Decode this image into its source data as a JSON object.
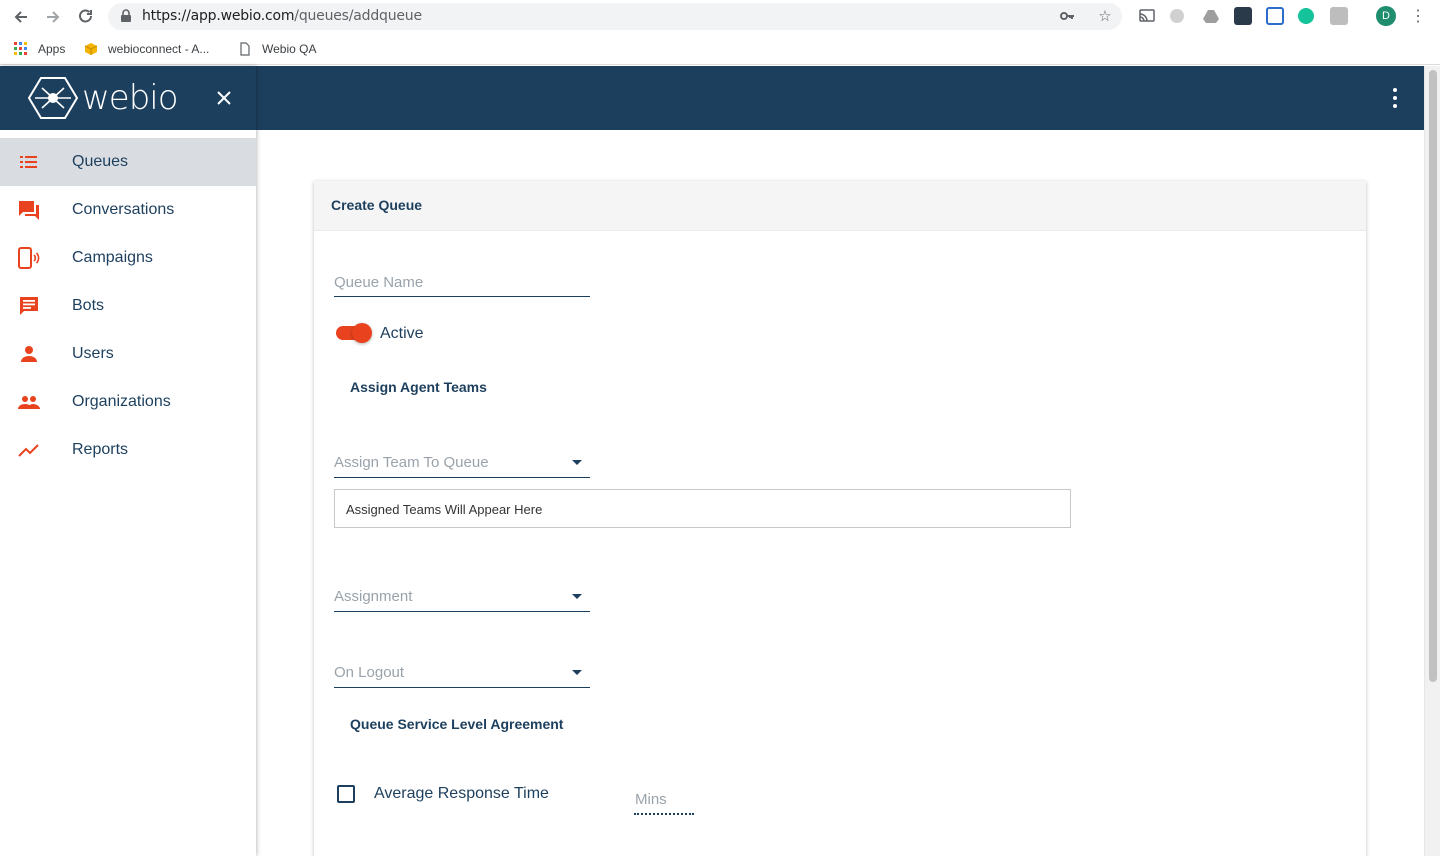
{
  "browser": {
    "url_host": "https://app.webio.com",
    "url_path": "/queues/addqueue",
    "profile_initial": "D",
    "bookmarks": [
      {
        "label": "Apps"
      },
      {
        "label": "webioconnect - A..."
      },
      {
        "label": "Webio QA"
      }
    ]
  },
  "app": {
    "logo_text": "webio",
    "accent_color": "#e8431e",
    "brand_color": "#1d3f5e"
  },
  "sidebar": {
    "items": [
      {
        "label": "Queues",
        "icon": "list-icon",
        "active": true
      },
      {
        "label": "Conversations",
        "icon": "chat-icon"
      },
      {
        "label": "Campaigns",
        "icon": "phone-broadcast-icon"
      },
      {
        "label": "Bots",
        "icon": "message-icon"
      },
      {
        "label": "Users",
        "icon": "person-icon"
      },
      {
        "label": "Organizations",
        "icon": "people-icon"
      },
      {
        "label": "Reports",
        "icon": "trending-up-icon"
      }
    ]
  },
  "form": {
    "title": "Create Queue",
    "queue_name_placeholder": "Queue Name",
    "active_label": "Active",
    "active_on": true,
    "assign_agent_teams_title": "Assign Agent Teams",
    "assign_team_placeholder": "Assign Team To Queue",
    "assigned_teams_text": "Assigned Teams Will Appear Here",
    "assignment_placeholder": "Assignment",
    "on_logout_placeholder": "On Logout",
    "sla_title": "Queue Service Level Agreement",
    "avg_response_label": "Average Response Time",
    "mins_placeholder": "Mins"
  }
}
